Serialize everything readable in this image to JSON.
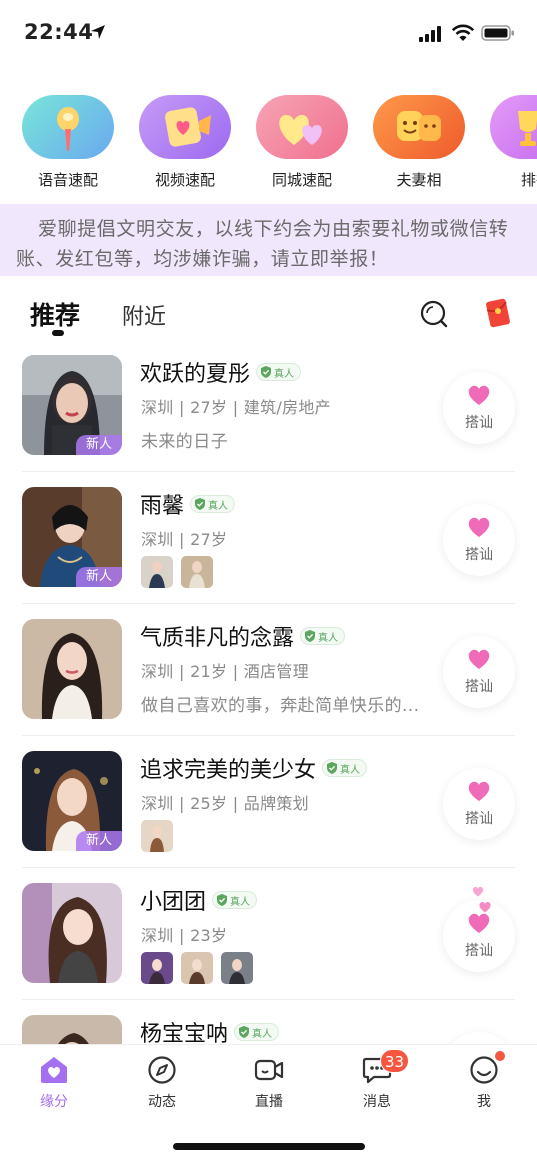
{
  "status_bar": {
    "time": "22:44"
  },
  "quick_match": [
    {
      "label": "语音速配",
      "icon": "microphone-icon",
      "color": "#6fc7e8"
    },
    {
      "label": "视频速配",
      "icon": "video-card-icon",
      "color": "#b27cf0"
    },
    {
      "label": "同城速配",
      "icon": "hearts-icon",
      "color": "#f38fa6"
    },
    {
      "label": "夫妻相",
      "icon": "couple-face-icon",
      "color": "#f07a3e"
    },
    {
      "label": "排行",
      "icon": "trophy-icon",
      "color": "#d67ef5"
    }
  ],
  "notice": "爱聊提倡文明交友，以线下约会为由索要礼物或微信转账、发红包等，均涉嫌诈骗，请立即举报！",
  "tabs": {
    "recommend": "推荐",
    "nearby": "附近"
  },
  "verified_label": "真人",
  "new_badge": "新人",
  "chat_label": "搭讪",
  "users": [
    {
      "name": "欢跃的夏彤",
      "meta": "深圳 | 27岁 | 建筑/房地产",
      "bio": "未来的日子",
      "is_new": true,
      "photo_count": 0
    },
    {
      "name": "雨馨",
      "meta": "深圳 | 27岁",
      "bio": "",
      "is_new": true,
      "photo_count": 2
    },
    {
      "name": "气质非凡的念露",
      "meta": "深圳 | 21岁 | 酒店管理",
      "bio": "做自己喜欢的事，奔赴简单快乐的...",
      "is_new": false,
      "photo_count": 0
    },
    {
      "name": "追求完美的美少女",
      "meta": "深圳 | 25岁 | 品牌策划",
      "bio": "",
      "is_new": true,
      "photo_count": 1
    },
    {
      "name": "小团团",
      "meta": "深圳 | 23岁",
      "bio": "",
      "is_new": false,
      "photo_count": 3
    },
    {
      "name": "杨宝宝呐",
      "meta": "",
      "bio": "",
      "is_new": false,
      "photo_count": 0
    }
  ],
  "bottom_nav": {
    "items": [
      {
        "label": "缘分",
        "icon": "home-heart-icon",
        "active": true
      },
      {
        "label": "动态",
        "icon": "compass-icon",
        "active": false
      },
      {
        "label": "直播",
        "icon": "video-camera-icon",
        "active": false
      },
      {
        "label": "消息",
        "icon": "chat-bubble-icon",
        "active": false,
        "badge": "33"
      },
      {
        "label": "我",
        "icon": "smiley-icon",
        "active": false
      }
    ]
  },
  "colors": {
    "accent": "#a470f0",
    "heart": "#f06bb7",
    "badge": "#f4563f",
    "notice_bg": "#f1e7fd"
  }
}
